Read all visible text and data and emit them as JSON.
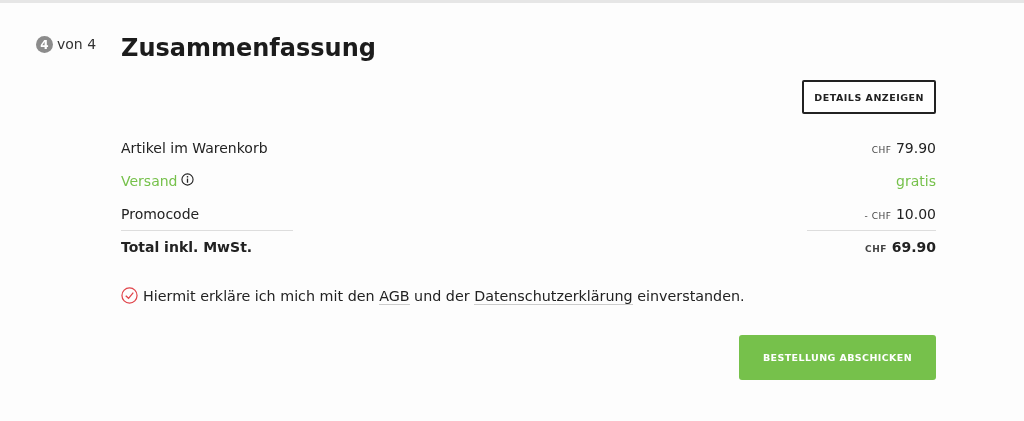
{
  "step": {
    "number": "4",
    "label": "von 4"
  },
  "title": "Zusammenfassung",
  "details_button": "DETAILS ANZEIGEN",
  "rows": [
    {
      "kind": "item",
      "label": "Artikel im Warenkorb",
      "currency": "CHF",
      "amount": "79.90"
    },
    {
      "kind": "shipping",
      "label": "Versand",
      "value": "gratis"
    },
    {
      "kind": "discount",
      "label": "Promocode",
      "currency": "- CHF",
      "amount": "10.00"
    },
    {
      "kind": "total",
      "label": "Total inkl. MwSt.",
      "currency": "CHF",
      "amount": "69.90"
    }
  ],
  "consent": {
    "checked": true,
    "parts": [
      {
        "kind": "text",
        "text": "Hiermit erkläre ich mich mit den "
      },
      {
        "kind": "link",
        "text": "AGB"
      },
      {
        "kind": "text",
        "text": " und der "
      },
      {
        "kind": "link",
        "text": "Datenschutzerklärung"
      },
      {
        "kind": "text",
        "text": " einverstanden."
      }
    ]
  },
  "submit_button": "BESTELLUNG ABSCHICKEN"
}
